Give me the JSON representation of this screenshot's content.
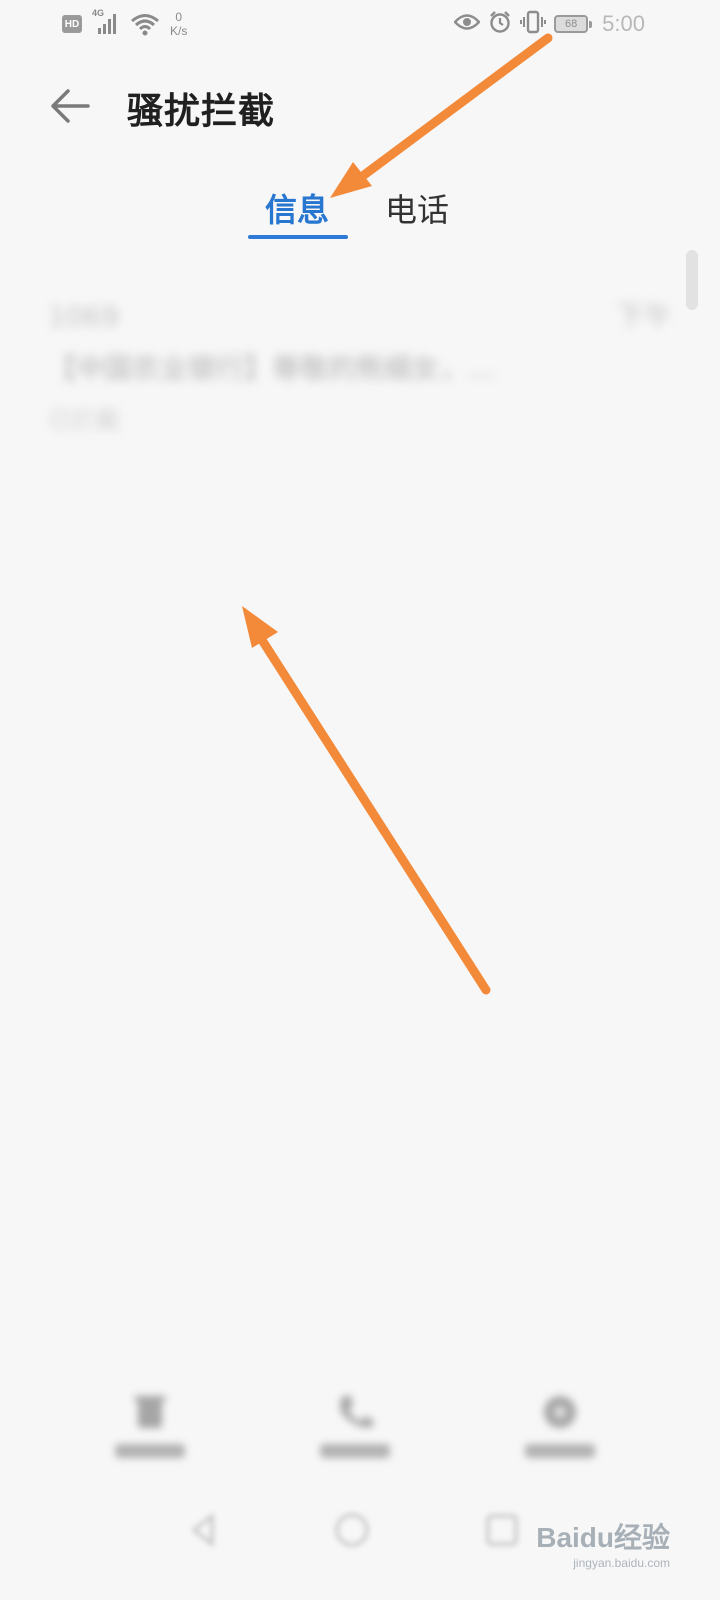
{
  "status_bar": {
    "hd": "HD",
    "network": "4G",
    "speed_value": "0",
    "speed_unit": "K/s",
    "battery_level": "68",
    "time": "5:00"
  },
  "header": {
    "title": "骚扰拦截"
  },
  "tabs": [
    {
      "label": "信息",
      "active": true
    },
    {
      "label": "电话",
      "active": false
    }
  ],
  "colors": {
    "accent": "#2776cf",
    "annotation_arrow": "#f28a3a"
  },
  "messages": [
    {
      "number": "1069",
      "time": "下午",
      "preview": "【中国农业银行】尊敬的熊细女，…",
      "status": "已拦截"
    },
    {
      "number": "",
      "time": "",
      "preview": "",
      "status": ""
    },
    {
      "number": "",
      "time": "",
      "preview": "",
      "status": ""
    },
    {
      "number": "",
      "time": "",
      "preview": "",
      "status": ""
    },
    {
      "number": "",
      "time": "",
      "preview": "",
      "status": ""
    },
    {
      "number": "",
      "time": "",
      "preview": "",
      "status": ""
    }
  ],
  "watermark": {
    "brand": "Baidu经验",
    "url": "jingyan.baidu.com"
  }
}
